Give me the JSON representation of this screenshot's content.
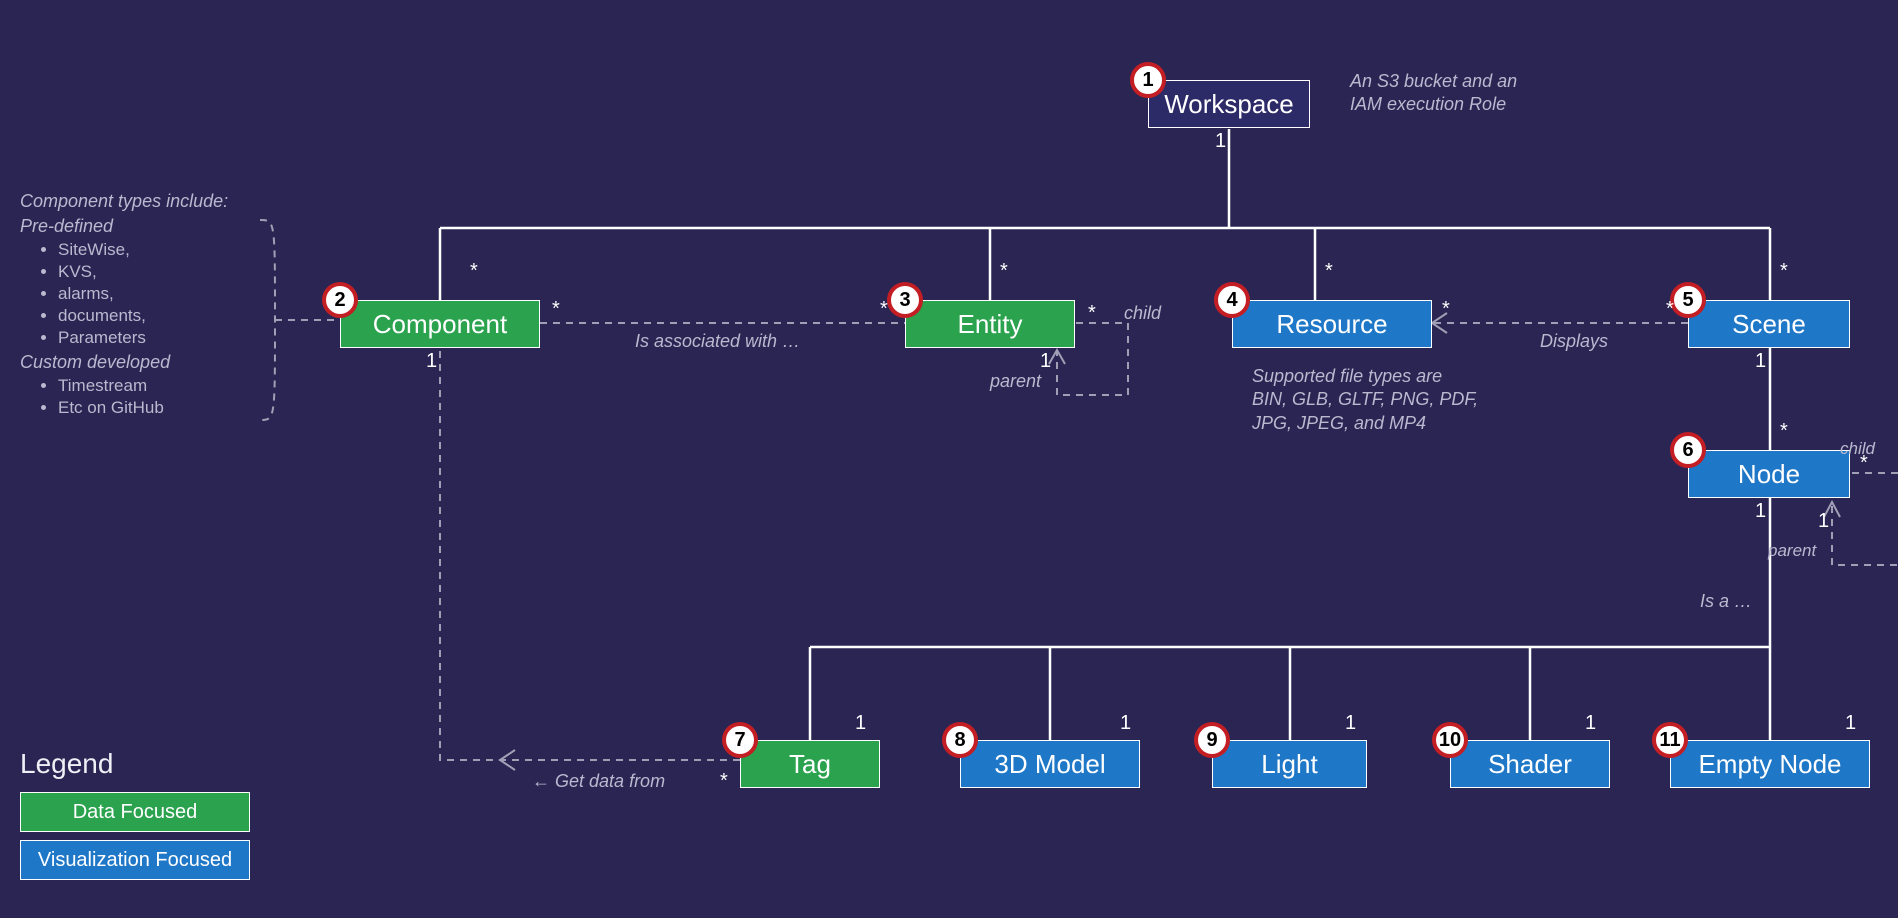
{
  "nodes": {
    "workspace": {
      "num": "1",
      "label": "Workspace"
    },
    "component": {
      "num": "2",
      "label": "Component"
    },
    "entity": {
      "num": "3",
      "label": "Entity"
    },
    "resource": {
      "num": "4",
      "label": "Resource"
    },
    "scene": {
      "num": "5",
      "label": "Scene"
    },
    "node": {
      "num": "6",
      "label": "Node"
    },
    "tag": {
      "num": "7",
      "label": "Tag"
    },
    "model3d": {
      "num": "8",
      "label": "3D Model"
    },
    "light": {
      "num": "9",
      "label": "Light"
    },
    "shader": {
      "num": "10",
      "label": "Shader"
    },
    "emptynode": {
      "num": "11",
      "label": "Empty Node"
    }
  },
  "annotations": {
    "workspace_note_l1": "An S3 bucket and an",
    "workspace_note_l2": "IAM execution Role",
    "resource_note_l1": "Supported file types are",
    "resource_note_l2": "BIN, GLB, GLTF, PNG, PDF,",
    "resource_note_l3": "JPG, JPEG, and MP4",
    "component_title": "Component types include:",
    "component_sub1": "Pre-defined",
    "component_li1": "SiteWise,",
    "component_li2": "KVS,",
    "component_li3": "alarms,",
    "component_li4": "documents,",
    "component_li5": "Parameters",
    "component_sub2": "Custom developed",
    "component_li6": "Timestream",
    "component_li7": "Etc on GitHub",
    "assoc": "Is associated with …",
    "displays": "Displays",
    "getdata": "Get data from",
    "isa": "Is a …",
    "child1": "child",
    "parent1": "parent",
    "child2": "child",
    "parent2": "parent"
  },
  "mult": {
    "m1": "1",
    "star": "*"
  },
  "legend": {
    "title": "Legend",
    "data": "Data Focused",
    "viz": "Visualization Focused"
  }
}
